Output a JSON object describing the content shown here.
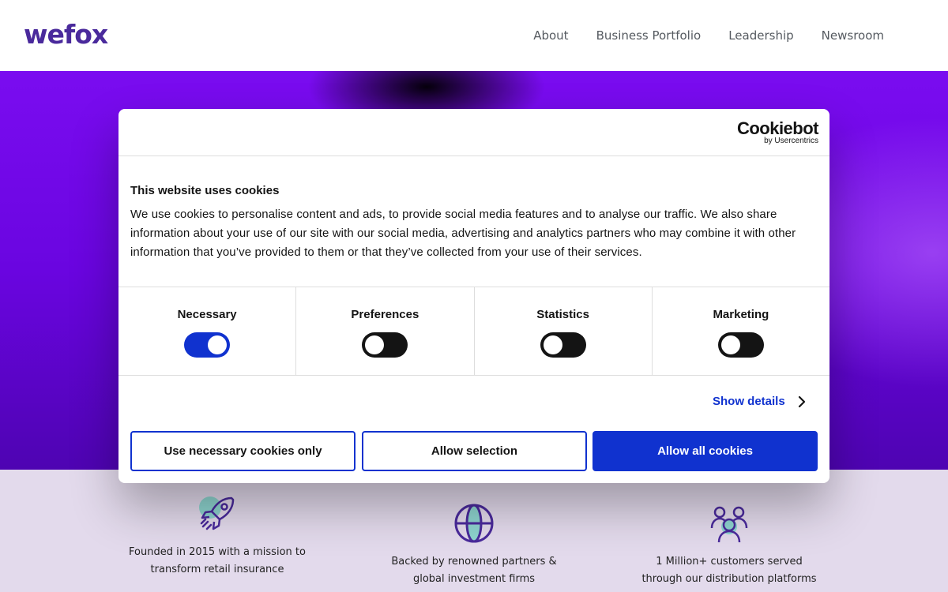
{
  "header": {
    "logo": "wefox",
    "nav": [
      "About",
      "Business Portfolio",
      "Leadership",
      "Newsroom"
    ]
  },
  "features": [
    {
      "icon": "rocket-icon",
      "text_line1": "Founded in 2015 with a mission to",
      "text_line2": "transform retail insurance"
    },
    {
      "icon": "globe-icon",
      "text_line1": "Backed by renowned partners &",
      "text_line2": "global investment firms"
    },
    {
      "icon": "people-icon",
      "text_line1": "1 Million+ customers served",
      "text_line2": "through our distribution platforms"
    }
  ],
  "cookie_dialog": {
    "brand": "Cookiebot",
    "brand_sub": "by Usercentrics",
    "title": "This website uses cookies",
    "text": "We use cookies to personalise content and ads, to provide social media features and to analyse our traffic. We also share information about your use of our site with our social media, advertising and analytics partners who may combine it with other information that you’ve provided to them or that they’ve collected from your use of their services.",
    "toggles": [
      {
        "label": "Necessary",
        "on": true
      },
      {
        "label": "Preferences",
        "on": false
      },
      {
        "label": "Statistics",
        "on": false
      },
      {
        "label": "Marketing",
        "on": false
      }
    ],
    "show_details": "Show details",
    "buttons": {
      "necessary_only": "Use necessary cookies only",
      "allow_selection": "Allow selection",
      "allow_all": "Allow all cookies"
    }
  },
  "colors": {
    "brand": "#4a2a9c",
    "accent": "#1032cf",
    "hero": "#7a0cf0",
    "features_bg": "#e3daec"
  }
}
